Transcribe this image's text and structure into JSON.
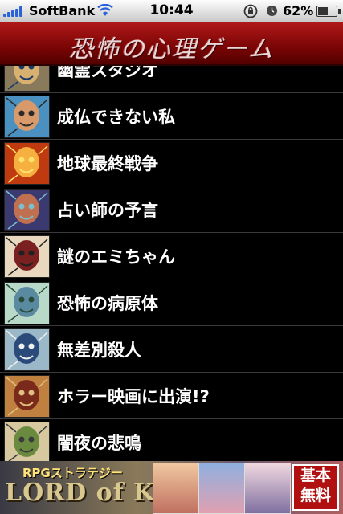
{
  "status_bar": {
    "carrier": "SoftBank",
    "time": "10:44",
    "battery_percent": "62%",
    "battery_level": 0.62
  },
  "header": {
    "title": "恐怖の心理ゲーム"
  },
  "list": {
    "items": [
      {
        "label": "幽霊スタジオ",
        "thumb": {
          "bg": "#8a7a5c",
          "fg": "#d8b070",
          "accent": "#1a3a6a"
        }
      },
      {
        "label": "成仏できない私",
        "thumb": {
          "bg": "#4a90c0",
          "fg": "#d89a6a",
          "accent": "#2a2a2a"
        }
      },
      {
        "label": "地球最終戦争",
        "thumb": {
          "bg": "#c03a10",
          "fg": "#f5b040",
          "accent": "#ffe070"
        }
      },
      {
        "label": "占い師の予言",
        "thumb": {
          "bg": "#3a3a70",
          "fg": "#c07050",
          "accent": "#7ac0d0"
        }
      },
      {
        "label": "謎のエミちゃん",
        "thumb": {
          "bg": "#e8d8c0",
          "fg": "#7a2020",
          "accent": "#202020"
        }
      },
      {
        "label": "恐怖の病原体",
        "thumb": {
          "bg": "#b8d8c8",
          "fg": "#5a8aa0",
          "accent": "#2a4a3a"
        }
      },
      {
        "label": "無差別殺人",
        "thumb": {
          "bg": "#9ab8c8",
          "fg": "#2a4a7a",
          "accent": "#f0f0f0"
        }
      },
      {
        "label": "ホラー映画に出演!?",
        "thumb": {
          "bg": "#c08040",
          "fg": "#7a2a1a",
          "accent": "#e0c080"
        }
      },
      {
        "label": "闇夜の悲鳴",
        "thumb": {
          "bg": "#d8c8a0",
          "fg": "#6a8a40",
          "accent": "#3a3a3a"
        }
      }
    ]
  },
  "ad": {
    "tagline": "RPGストラテジー",
    "logo": "LORD of KNIGHTS",
    "free_badge_line1": "基本",
    "free_badge_line2": "無料"
  }
}
